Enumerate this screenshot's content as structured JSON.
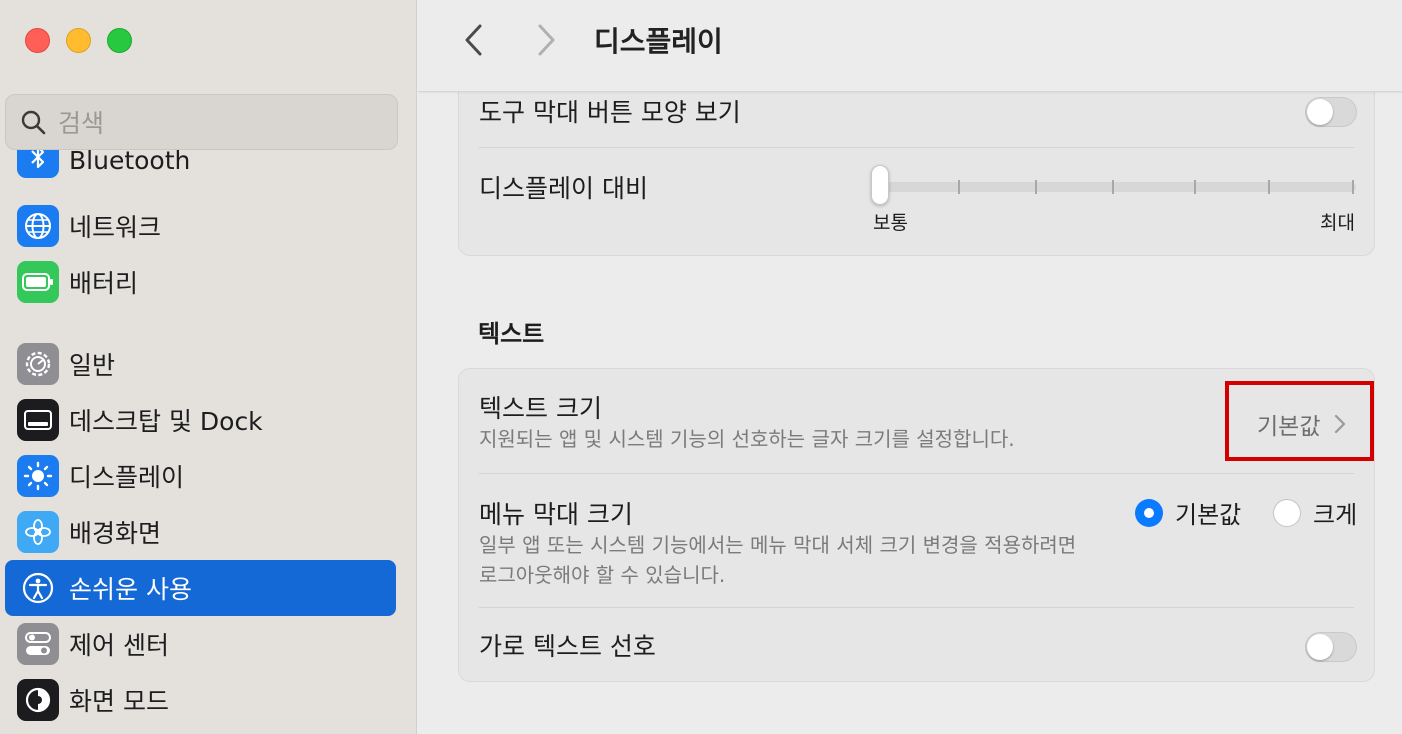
{
  "window": {
    "title": "디스플레이"
  },
  "search": {
    "placeholder": "검색"
  },
  "sidebar": {
    "items": [
      {
        "label": "Bluetooth",
        "icon": "bluetooth-icon",
        "color": "#1a7cf0"
      },
      {
        "label": "네트워크",
        "icon": "globe-icon",
        "color": "#1a7cf0"
      },
      {
        "label": "배터리",
        "icon": "battery-icon",
        "color": "#34c759"
      },
      {
        "label": "일반",
        "icon": "gear-icon",
        "color": "#8e8e93"
      },
      {
        "label": "데스크탑 및 Dock",
        "icon": "dock-icon",
        "color": "#1c1c1e"
      },
      {
        "label": "디스플레이",
        "icon": "sun-icon",
        "color": "#1a7cf0"
      },
      {
        "label": "배경화면",
        "icon": "flower-icon",
        "color": "#3fa9f5"
      },
      {
        "label": "손쉬운 사용",
        "icon": "accessibility-icon",
        "color": "#1469d6",
        "active": true
      },
      {
        "label": "제어 센터",
        "icon": "control-center-icon",
        "color": "#8e8e93"
      },
      {
        "label": "화면 모드",
        "icon": "appearance-icon",
        "color": "#1c1c1e"
      }
    ]
  },
  "display_card": {
    "toolbar_button_shapes": {
      "label": "도구 막대 버튼 모양 보기",
      "on": false
    },
    "contrast": {
      "label": "디스플레이 대비",
      "min_label": "보통",
      "max_label": "최대",
      "value": 0
    }
  },
  "text_section": {
    "title": "텍스트",
    "text_size": {
      "label": "텍스트 크기",
      "description": "지원되는 앱 및 시스템 기능의 선호하는 글자 크기를 설정합니다.",
      "value": "기본값"
    },
    "menu_bar_size": {
      "label": "메뉴 막대 크기",
      "description_line1": "일부 앱 또는 시스템 기능에서는 메뉴 막대 서체 크기 변경을 적용하려면",
      "description_line2": "로그아웃해야 할 수 있습니다.",
      "options": [
        "기본값",
        "크게"
      ],
      "selected": "기본값"
    },
    "prefer_horizontal_text": {
      "label": "가로 텍스트 선호",
      "on": false
    }
  },
  "colors": {
    "accent": "#0a7aff",
    "sidebar_active": "#1469d6",
    "highlight": "#d40000"
  }
}
